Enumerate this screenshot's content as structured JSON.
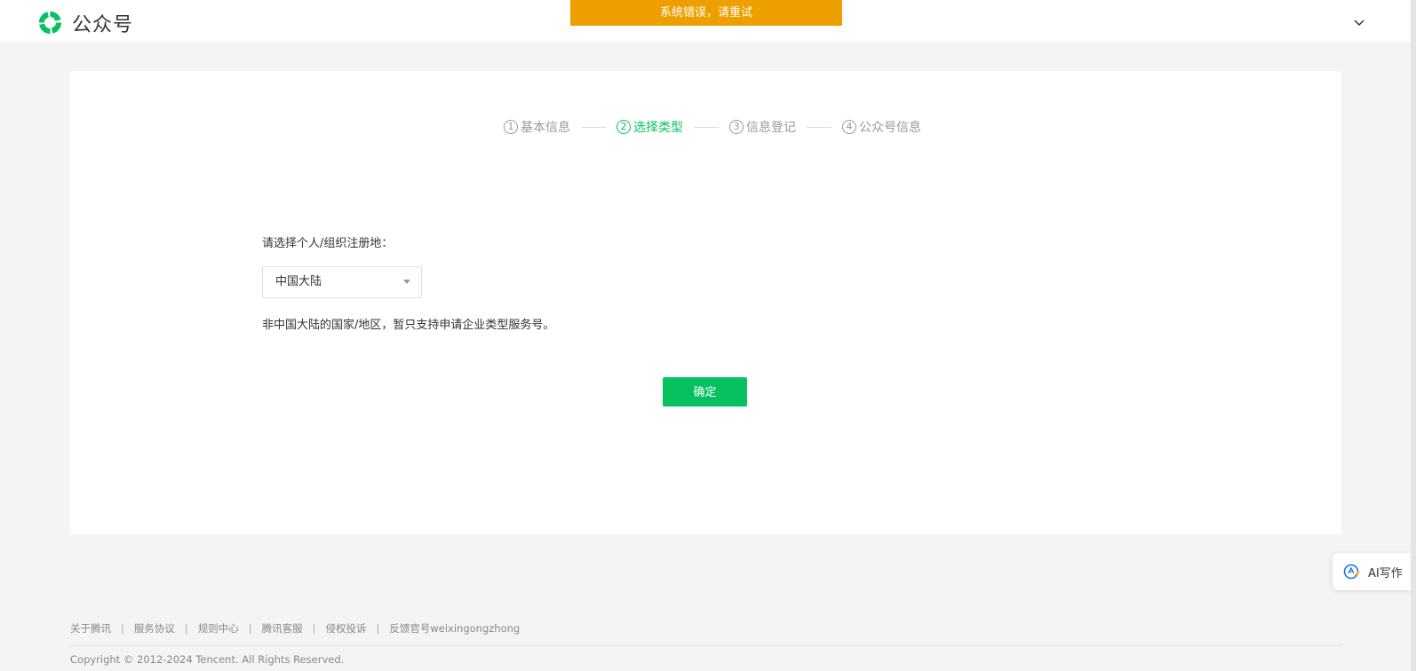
{
  "header": {
    "logo_text": "公众号",
    "error_banner": "系统错误，请重试"
  },
  "steps": [
    {
      "num": "1",
      "label": "基本信息",
      "active": false
    },
    {
      "num": "2",
      "label": "选择类型",
      "active": true
    },
    {
      "num": "3",
      "label": "信息登记",
      "active": false
    },
    {
      "num": "4",
      "label": "公众号信息",
      "active": false
    }
  ],
  "form": {
    "region_label": "请选择个人/组织注册地：",
    "region_selected": "中国大陆",
    "region_note": "非中国大陆的国家/地区，暂只支持申请企业类型服务号。",
    "confirm_label": "确定"
  },
  "ai_widget": {
    "label": "AI写作"
  },
  "footer": {
    "links": [
      "关于腾讯",
      "服务协议",
      "规则中心",
      "腾讯客服",
      "侵权投诉",
      "反馈官号weixingongzhong"
    ],
    "copyright": "Copyright © 2012-2024 Tencent. All Rights Reserved."
  },
  "colors": {
    "brand": "#07c160",
    "banner": "#ee9f00"
  }
}
